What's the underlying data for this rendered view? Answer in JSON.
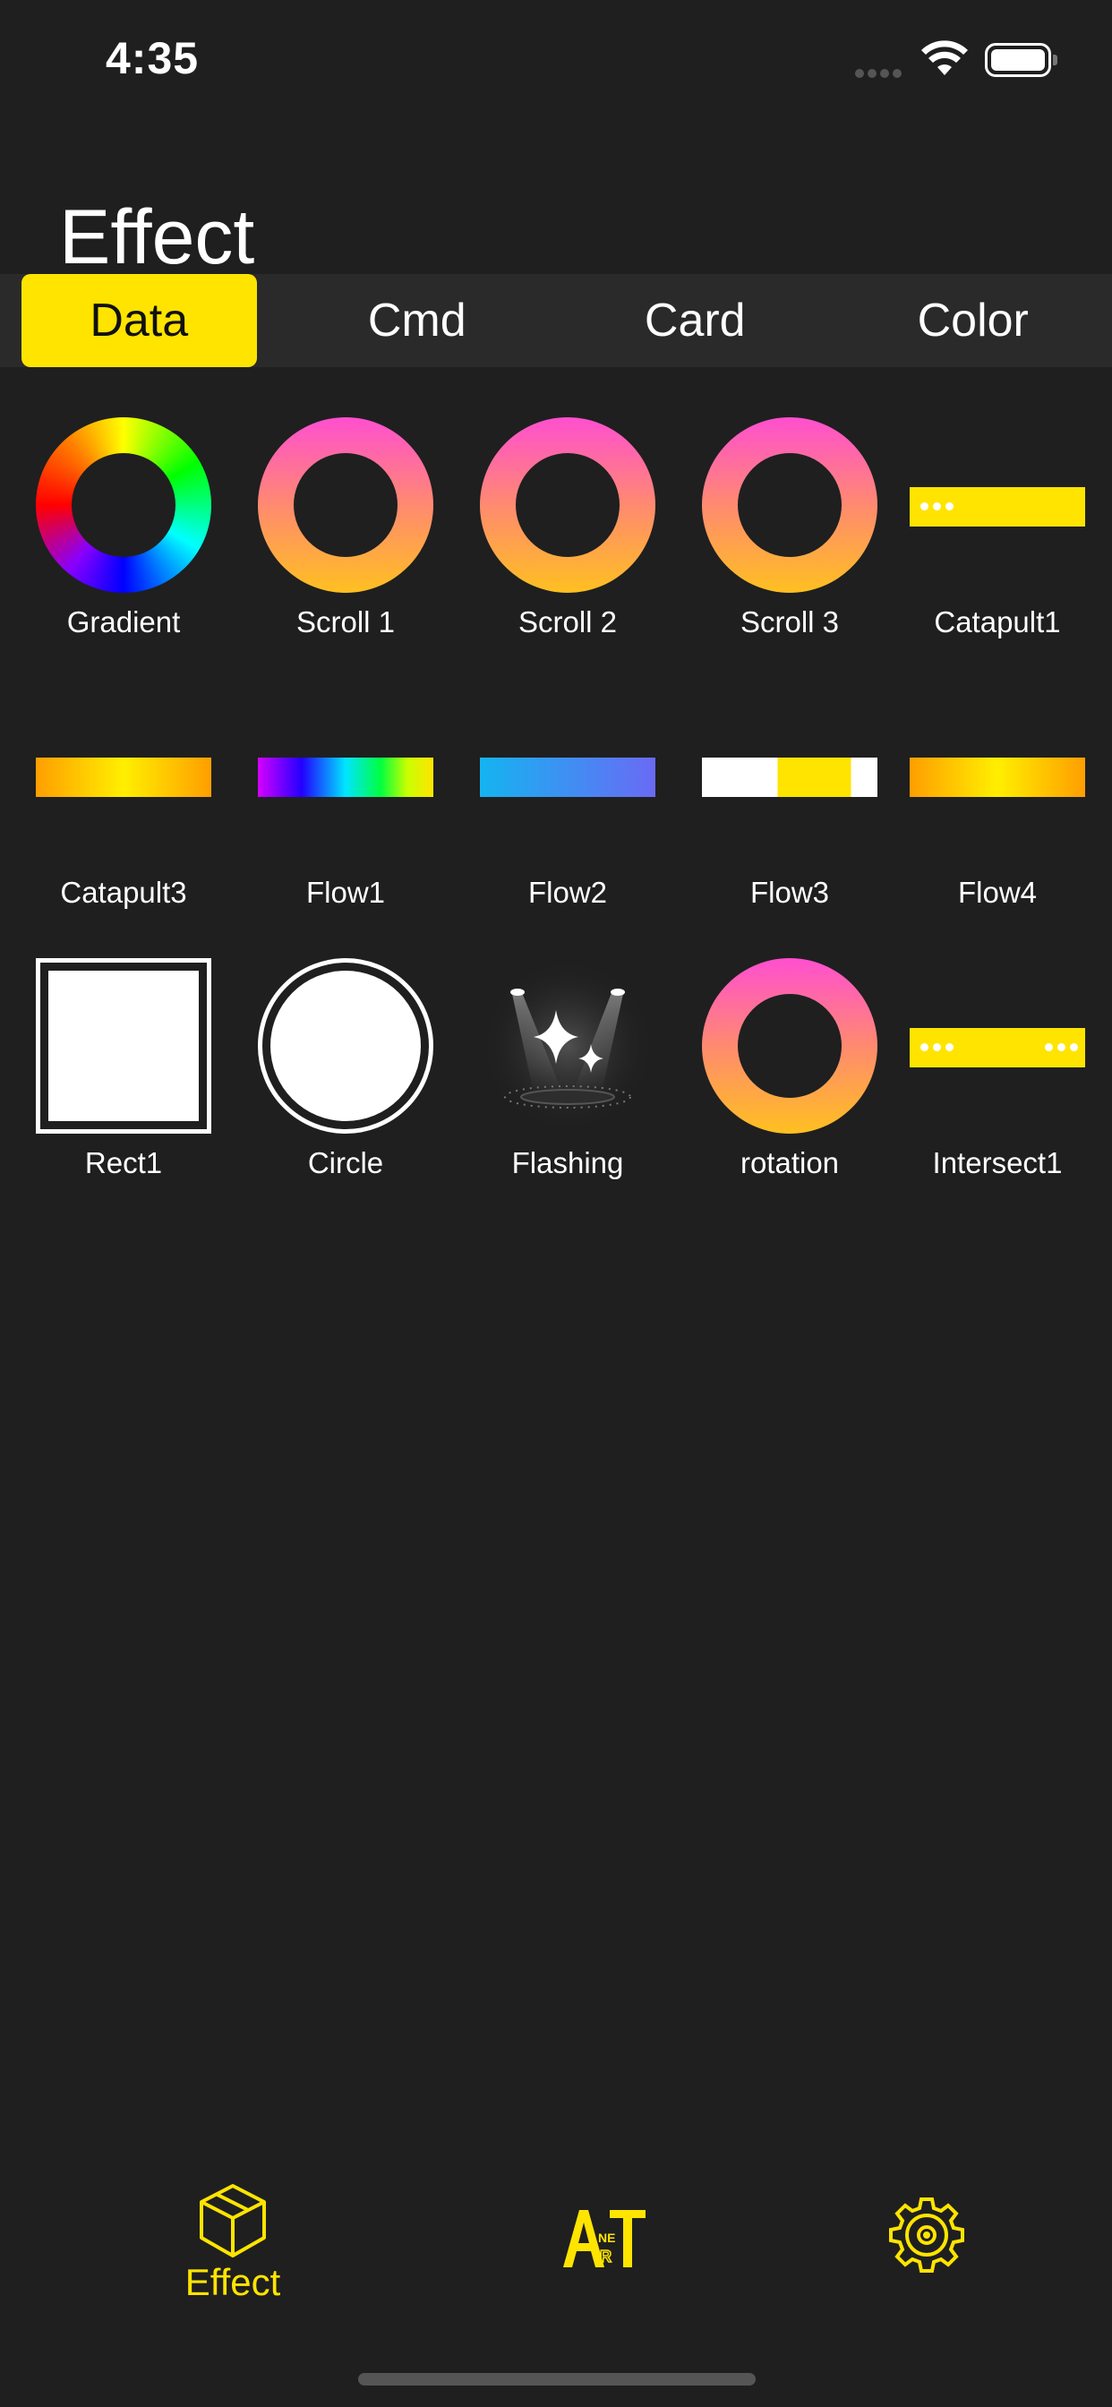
{
  "status": {
    "time": "4:35"
  },
  "page": {
    "title": "Effect"
  },
  "tabs": [
    {
      "label": "Data",
      "active": true
    },
    {
      "label": "Cmd",
      "active": false
    },
    {
      "label": "Card",
      "active": false
    },
    {
      "label": "Color",
      "active": false
    }
  ],
  "effects": [
    {
      "label": "Gradient",
      "icon": "rainbow-ring-icon"
    },
    {
      "label": "Scroll 1",
      "icon": "gradient-ring-icon"
    },
    {
      "label": "Scroll 2",
      "icon": "gradient-ring-icon"
    },
    {
      "label": "Scroll 3",
      "icon": "gradient-ring-icon"
    },
    {
      "label": "Catapult1",
      "icon": "yellow-bar-dots-icon"
    },
    {
      "label": "Catapult3",
      "icon": "orange-gradient-bar-icon"
    },
    {
      "label": "Flow1",
      "icon": "rainbow-bar-icon"
    },
    {
      "label": "Flow2",
      "icon": "blue-gradient-bar-icon"
    },
    {
      "label": "Flow3",
      "icon": "white-yellow-bar-icon"
    },
    {
      "label": "Flow4",
      "icon": "orange-gradient-bar-icon"
    },
    {
      "label": "Rect1",
      "icon": "square-icon"
    },
    {
      "label": "Circle",
      "icon": "circle-icon"
    },
    {
      "label": "Flashing",
      "icon": "spotlight-sparkle-icon"
    },
    {
      "label": "rotation",
      "icon": "gradient-ring-icon"
    },
    {
      "label": "Intersect1",
      "icon": "yellow-bar-dots-both-icon"
    }
  ],
  "bottom_nav": {
    "effect_label": "Effect",
    "art_icon": "art-icon",
    "settings_icon": "gear-icon"
  },
  "colors": {
    "accent": "#ffe400",
    "background": "#1f1f1f",
    "tab_bar": "#2a2a2a"
  }
}
